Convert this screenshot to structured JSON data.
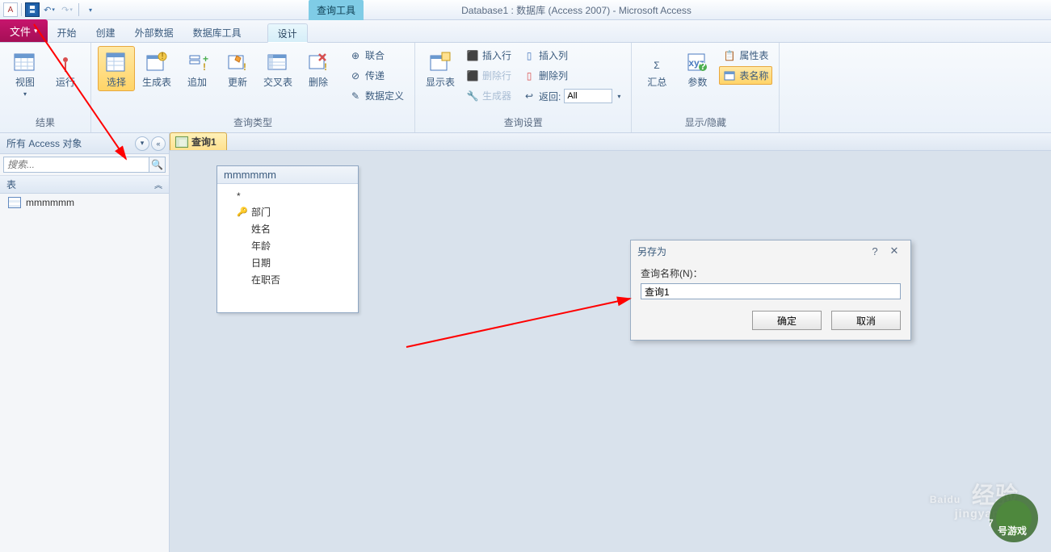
{
  "app_title": "Database1 : 数据库 (Access 2007) - Microsoft Access",
  "tool_context": "查询工具",
  "tabs": {
    "file": "文件",
    "home": "开始",
    "create": "创建",
    "external": "外部数据",
    "dbtools": "数据库工具",
    "design": "设计"
  },
  "ribbon": {
    "group_results": "结果",
    "group_querytype": "查询类型",
    "group_querysetup": "查询设置",
    "group_showhide": "显示/隐藏",
    "view": "视图",
    "run": "运行",
    "select": "选择",
    "maketable": "生成表",
    "append": "追加",
    "update": "更新",
    "crosstab": "交叉表",
    "delete": "删除",
    "union": "联合",
    "passthrough": "传递",
    "datadef": "数据定义",
    "showtable": "显示表",
    "insertrows": "插入行",
    "deleterows": "删除行",
    "builder": "生成器",
    "insertcols": "插入列",
    "deletecols": "删除列",
    "returnlbl": "返回:",
    "returnval": "All",
    "totals": "汇总",
    "params": "参数",
    "propsheet": "属性表",
    "tablenames": "表名称"
  },
  "nav": {
    "header": "所有 Access 对象",
    "search_placeholder": "搜索...",
    "cat_tables": "表",
    "item_table": "mmmmmm"
  },
  "doc": {
    "tab": "查询1",
    "table_title": "mmmmmm",
    "fields": [
      "*",
      "部门",
      "姓名",
      "年龄",
      "日期",
      "在职否"
    ]
  },
  "dialog": {
    "title": "另存为",
    "label": "查询名称(N)：",
    "value": "查询1",
    "ok": "确定",
    "cancel": "取消"
  },
  "watermark": {
    "brand": "Baidu",
    "sub": "jingyan.ba",
    "tag": "经验",
    "game": "7号游戏"
  }
}
